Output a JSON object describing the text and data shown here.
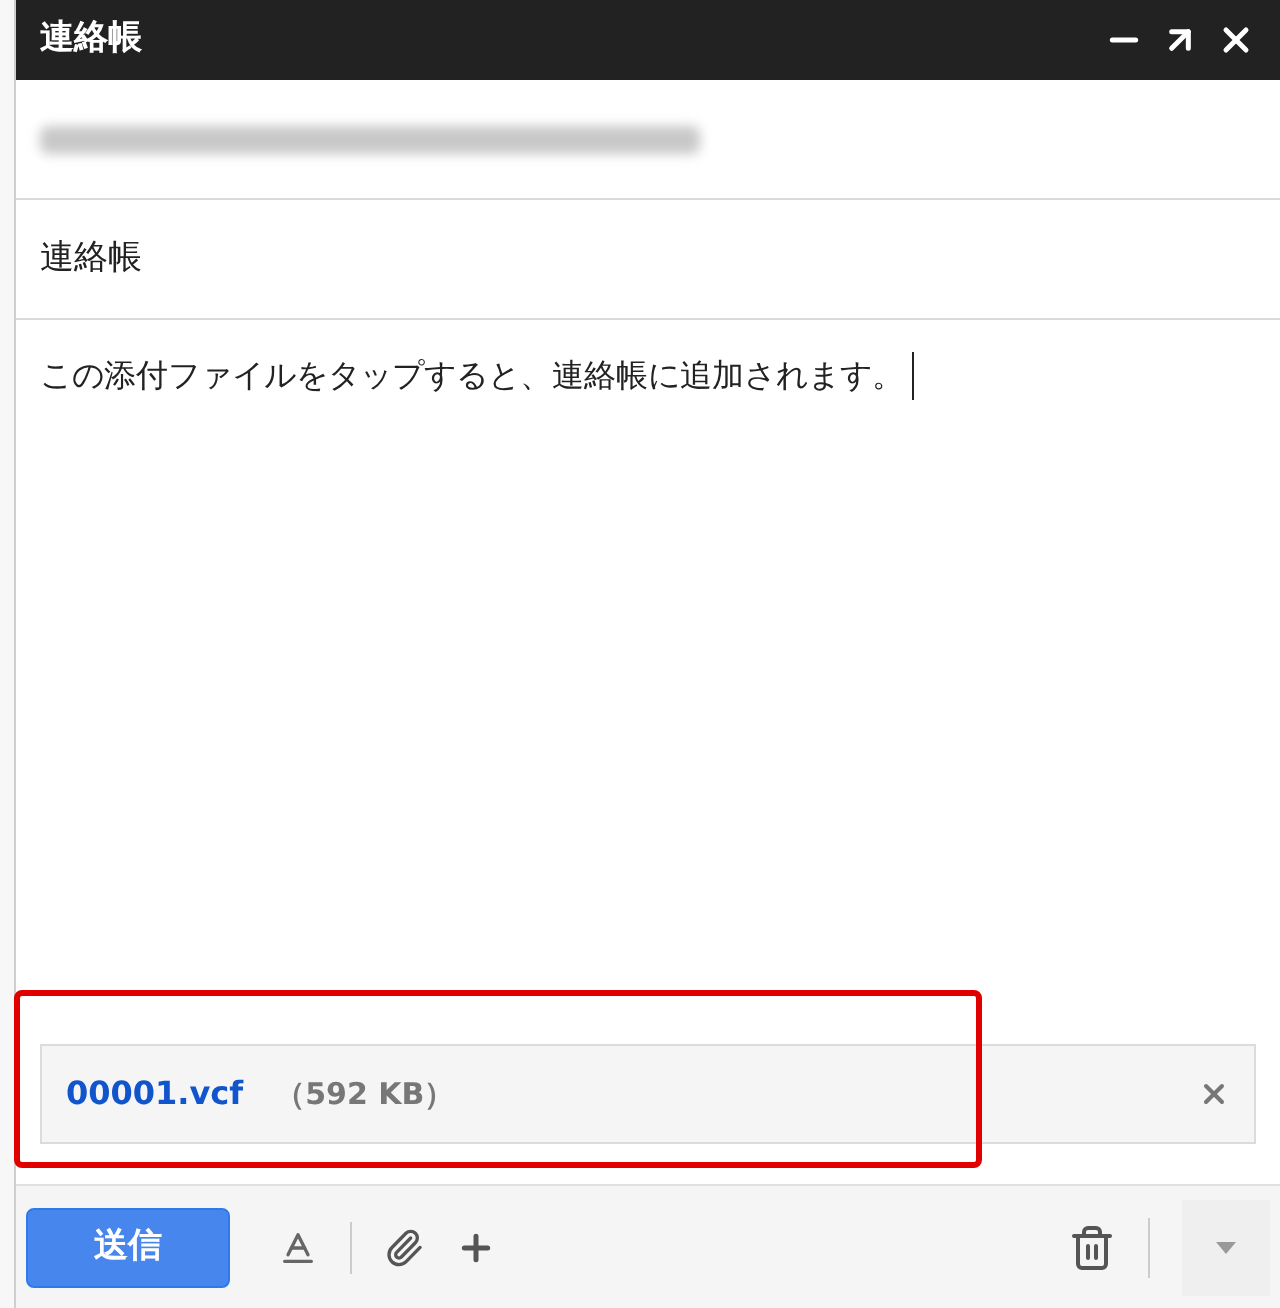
{
  "window": {
    "title": "連絡帳"
  },
  "subject": "連絡帳",
  "body": "この添付ファイルをタップすると、連絡帳に追加されます。",
  "attachment": {
    "name": "00001.vcf",
    "size": "（592 KB）"
  },
  "send_button": "送信"
}
